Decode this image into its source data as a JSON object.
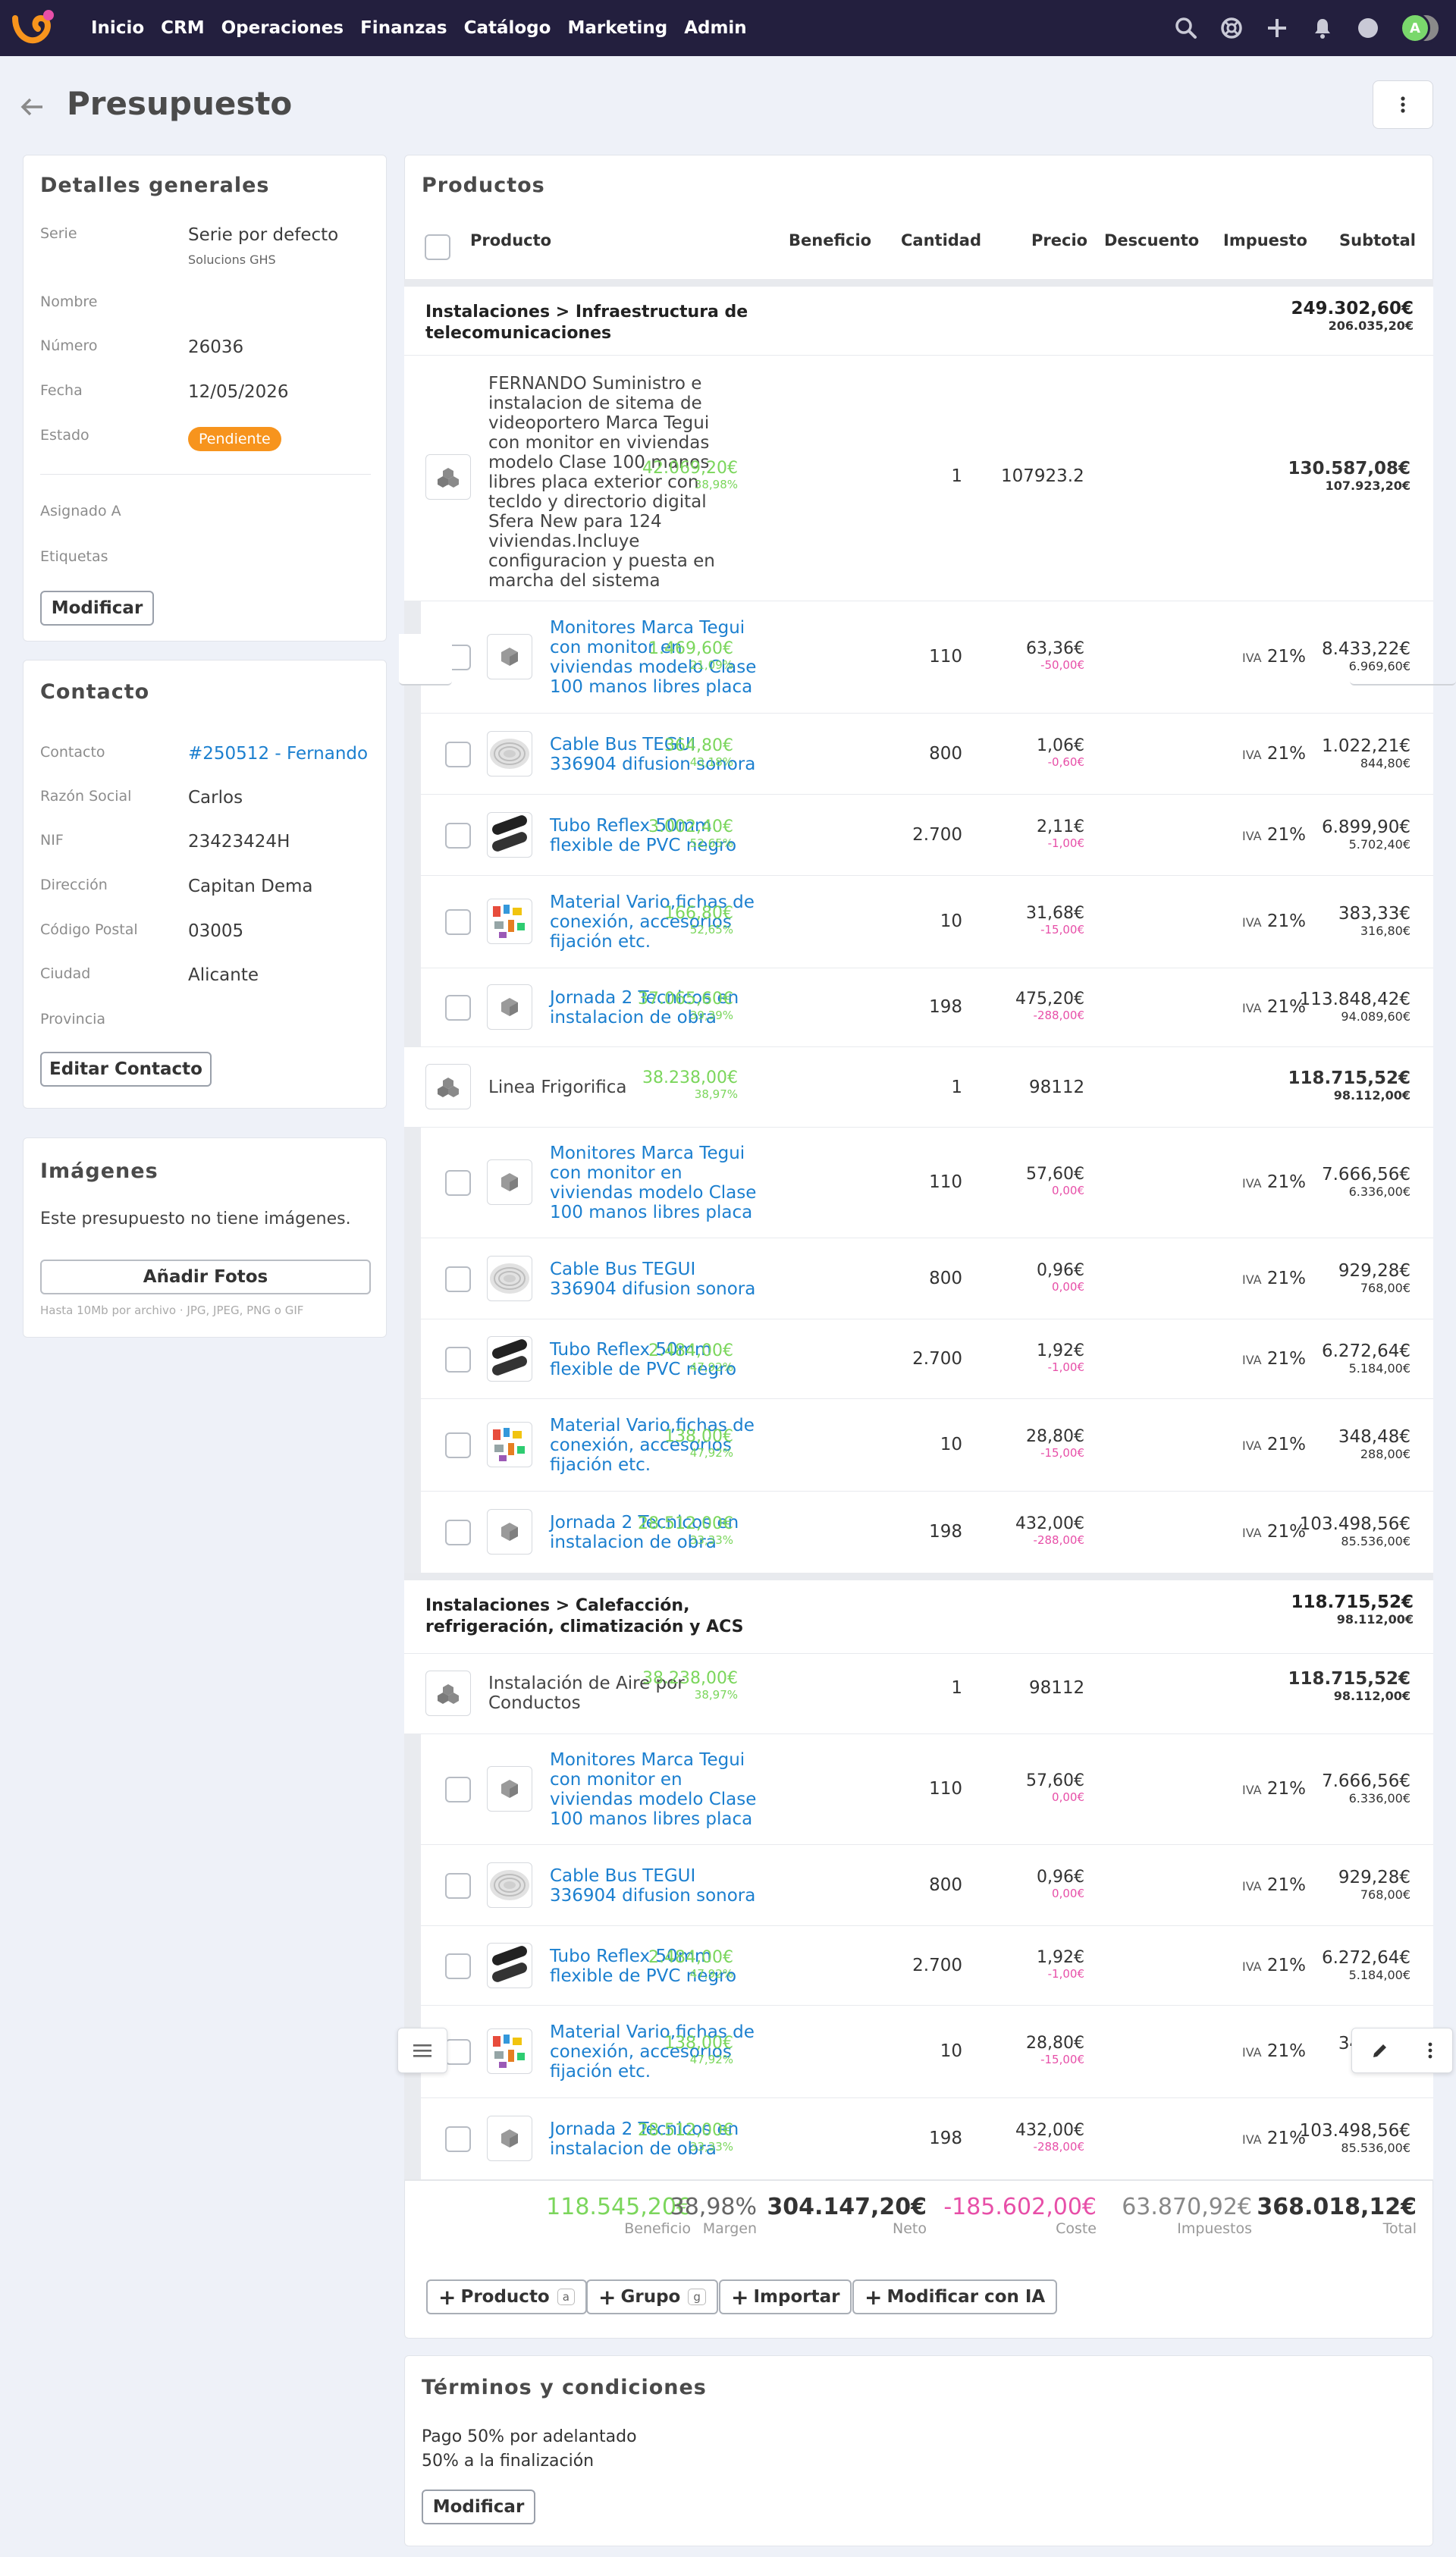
{
  "nav": {
    "items": [
      "Inicio",
      "CRM",
      "Operaciones",
      "Finanzas",
      "Catálogo",
      "Marketing",
      "Admin"
    ],
    "avatar_letter": "A"
  },
  "page": {
    "title": "Presupuesto"
  },
  "details": {
    "title": "Detalles generales",
    "serie_label": "Serie",
    "serie_value": "Serie por defecto",
    "serie_sub": "Solucions GHS",
    "nombre_label": "Nombre",
    "numero_label": "Número",
    "numero_value": "26036",
    "fecha_label": "Fecha",
    "fecha_value": "12/05/2026",
    "estado_label": "Estado",
    "estado_value": "Pendiente",
    "asignado_label": "Asignado A",
    "etiquetas_label": "Etiquetas",
    "modify_button": "Modificar"
  },
  "contact": {
    "title": "Contacto",
    "contacto_label": "Contacto",
    "contacto_value": "#250512 - Fernando",
    "razon_label": "Razón Social",
    "razon_value": "Carlos",
    "nif_label": "NIF",
    "nif_value": "23423424H",
    "direccion_label": "Dirección",
    "direccion_value": "Capitan Dema",
    "cp_label": "Código Postal",
    "cp_value": "03005",
    "ciudad_label": "Ciudad",
    "ciudad_value": "Alicante",
    "provincia_label": "Provincia",
    "edit_button": "Editar Contacto"
  },
  "images": {
    "title": "Imágenes",
    "empty": "Este presupuesto no tiene imágenes.",
    "add_button": "Añadir Fotos",
    "hint": "Hasta 10Mb por archivo · JPG, JPEG, PNG o GIF"
  },
  "products": {
    "title": "Productos",
    "columns": {
      "producto": "Producto",
      "beneficio": "Beneficio",
      "cantidad": "Cantidad",
      "precio": "Precio",
      "descuento": "Descuento",
      "impuesto": "Impuesto",
      "subtotal": "Subtotal"
    },
    "section1": {
      "title": "Instalaciones > Infraestructura de telecomunicaciones",
      "total": "249.302,60€",
      "net": "206.035,20€"
    },
    "group1": {
      "name": "FERNANDO Suministro e instalacion de sitema de videoportero Marca Tegui con monitor en viviendas modelo Clase 100 manos libres placa exterior con tecldo y directorio digital Sfera New para 124 viviendas.Incluye configuracion y puesta en marcha del sistema",
      "benefit": "42.069,20€",
      "margin": "38,98%",
      "qty": "1",
      "price": "107923.2",
      "subtotal": "130.587,08€",
      "net": "107.923,20€"
    },
    "g1_items": [
      {
        "name": "Monitores Marca Tegui con monitor en viviendas modelo Clase 100 manos libres placa",
        "benefit": "1.469,60€",
        "margin": "21,09%",
        "qty": "110",
        "price": "63,36€",
        "disc": "-50,00€",
        "tax_label": "IVA",
        "tax": "21%",
        "subtotal": "8.433,22€",
        "net": "6.969,60€"
      },
      {
        "name": "Cable Bus TEGUI 336904 difusion sonora",
        "benefit": "364,80€",
        "margin": "43,18%",
        "qty": "800",
        "price": "1,06€",
        "disc": "-0,60€",
        "tax_label": "IVA",
        "tax": "21%",
        "subtotal": "1.022,21€",
        "net": "844,80€"
      },
      {
        "name": "Tubo Reflex 50mm flexible de PVC negro",
        "benefit": "3.002,40€",
        "margin": "52,65%",
        "qty": "2.700",
        "price": "2,11€",
        "disc": "-1,00€",
        "tax_label": "IVA",
        "tax": "21%",
        "subtotal": "6.899,90€",
        "net": "5.702,40€"
      },
      {
        "name": "Material Vario,fichas de conexión, accesorios fijación etc.",
        "benefit": "166,80€",
        "margin": "52,65%",
        "qty": "10",
        "price": "31,68€",
        "disc": "-15,00€",
        "tax_label": "IVA",
        "tax": "21%",
        "subtotal": "383,33€",
        "net": "316,80€"
      },
      {
        "name": "Jornada 2 Tecnicos en instalacion de obra",
        "benefit": "37.065,60€",
        "margin": "39,39%",
        "qty": "198",
        "price": "475,20€",
        "disc": "-288,00€",
        "tax_label": "IVA",
        "tax": "21%",
        "subtotal": "113.848,42€",
        "net": "94.089,60€"
      }
    ],
    "group2": {
      "name": "Linea Frigorifica",
      "benefit": "38.238,00€",
      "margin": "38,97%",
      "qty": "1",
      "price": "98112",
      "subtotal": "118.715,52€",
      "net": "98.112,00€"
    },
    "g2_items": [
      {
        "name": "Monitores Marca Tegui con monitor en viviendas modelo Clase 100 manos libres placa",
        "benefit": "",
        "margin": "",
        "qty": "110",
        "price": "57,60€",
        "disc": "0,00€",
        "tax_label": "IVA",
        "tax": "21%",
        "subtotal": "7.666,56€",
        "net": "6.336,00€"
      },
      {
        "name": "Cable Bus TEGUI 336904 difusion sonora",
        "benefit": "",
        "margin": "",
        "qty": "800",
        "price": "0,96€",
        "disc": "0,00€",
        "tax_label": "IVA",
        "tax": "21%",
        "subtotal": "929,28€",
        "net": "768,00€"
      },
      {
        "name": "Tubo Reflex 50mm flexible de PVC negro",
        "benefit": "2.484,00€",
        "margin": "47,92%",
        "qty": "2.700",
        "price": "1,92€",
        "disc": "-1,00€",
        "tax_label": "IVA",
        "tax": "21%",
        "subtotal": "6.272,64€",
        "net": "5.184,00€"
      },
      {
        "name": "Material Vario,fichas de conexión, accesorios fijación etc.",
        "benefit": "138,00€",
        "margin": "47,92%",
        "qty": "10",
        "price": "28,80€",
        "disc": "-15,00€",
        "tax_label": "IVA",
        "tax": "21%",
        "subtotal": "348,48€",
        "net": "288,00€"
      },
      {
        "name": "Jornada 2 Tecnicos en instalacion de obra",
        "benefit": "28.512,00€",
        "margin": "33,33%",
        "qty": "198",
        "price": "432,00€",
        "disc": "-288,00€",
        "tax_label": "IVA",
        "tax": "21%",
        "subtotal": "103.498,56€",
        "net": "85.536,00€"
      }
    ],
    "section2": {
      "title": "Instalaciones > Calefacción, refrigeración, climatización y ACS",
      "total": "118.715,52€",
      "net": "98.112,00€"
    },
    "group3": {
      "name": "Instalación de Aire por Conductos",
      "benefit": "38.238,00€",
      "margin": "38,97%",
      "qty": "1",
      "price": "98112",
      "subtotal": "118.715,52€",
      "net": "98.112,00€"
    },
    "g3_items": [
      {
        "name": "Monitores Marca Tegui con monitor en viviendas modelo Clase 100 manos libres placa",
        "benefit": "",
        "margin": "",
        "qty": "110",
        "price": "57,60€",
        "disc": "0,00€",
        "tax_label": "IVA",
        "tax": "21%",
        "subtotal": "7.666,56€",
        "net": "6.336,00€"
      },
      {
        "name": "Cable Bus TEGUI 336904 difusion sonora",
        "benefit": "",
        "margin": "",
        "qty": "800",
        "price": "0,96€",
        "disc": "0,00€",
        "tax_label": "IVA",
        "tax": "21%",
        "subtotal": "929,28€",
        "net": "768,00€"
      },
      {
        "name": "Tubo Reflex 50mm flexible de PVC negro",
        "benefit": "2.484,00€",
        "margin": "47,92%",
        "qty": "2.700",
        "price": "1,92€",
        "disc": "-1,00€",
        "tax_label": "IVA",
        "tax": "21%",
        "subtotal": "6.272,64€",
        "net": "5.184,00€"
      },
      {
        "name": "Material Vario,fichas de conexión, accesorios fijación etc.",
        "benefit": "138,00€",
        "margin": "47,92%",
        "qty": "10",
        "price": "28,80€",
        "disc": "-15,00€",
        "tax_label": "IVA",
        "tax": "21%",
        "subtotal": "348,48€",
        "net": "288,00€"
      },
      {
        "name": "Jornada 2 Tecnicos en instalacion de obra",
        "benefit": "28.512,00€",
        "margin": "33,33%",
        "qty": "198",
        "price": "432,00€",
        "disc": "-288,00€",
        "tax_label": "IVA",
        "tax": "21%",
        "subtotal": "103.498,56€",
        "net": "85.536,00€"
      }
    ],
    "summary": {
      "beneficio_value": "118.545,20€",
      "beneficio_label": "Beneficio",
      "margen_value": "38,98%",
      "margen_label": "Margen",
      "neto_value": "304.147,20€",
      "neto_label": "Neto",
      "coste_value": "-185.602,00€",
      "coste_label": "Coste",
      "impuestos_value": "63.870,92€",
      "impuestos_label": "Impuestos",
      "total_value": "368.018,12€",
      "total_label": "Total"
    },
    "actions": {
      "producto": "Producto",
      "producto_key": "a",
      "grupo": "Grupo",
      "grupo_key": "g",
      "importar": "Importar",
      "ia": "Modificar con IA"
    }
  },
  "terms": {
    "title": "Términos y condiciones",
    "line1": "Pago 50% por adelantado",
    "line2": "50% a la finalización",
    "modify_button": "Modificar"
  },
  "colors": {
    "navbar": "#231f3e",
    "accent_orange": "#f7941d",
    "positive": "#7bd65c",
    "negative": "#e74fa8",
    "link": "#1b7fcf"
  }
}
